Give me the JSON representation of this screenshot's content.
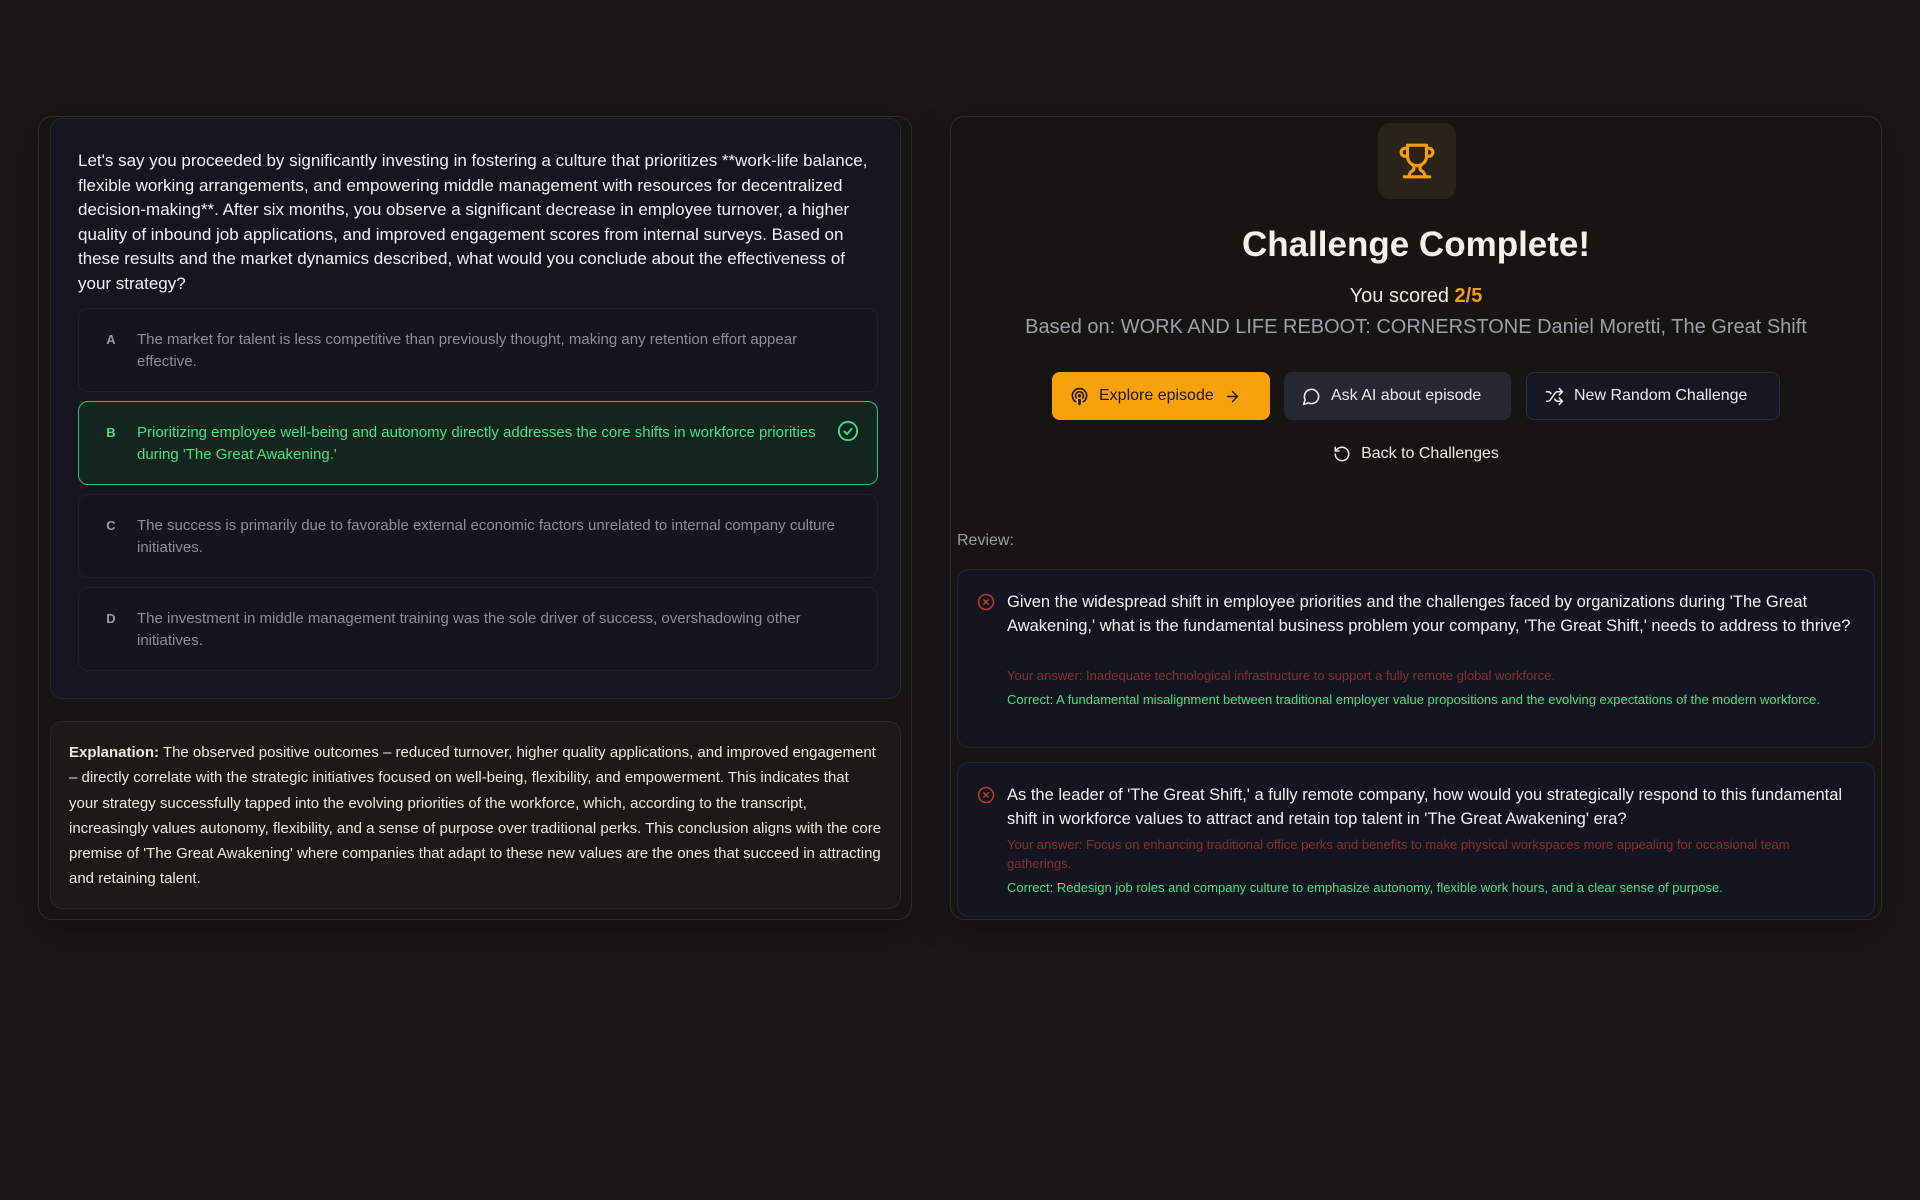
{
  "question": {
    "text": "Let's say you proceeded by significantly investing in fostering a culture that prioritizes **work-life balance, flexible working arrangements, and empowering middle management with resources for decentralized decision-making**. After six months, you observe a significant decrease in employee turnover, a higher quality of inbound job applications, and improved engagement scores from internal surveys. Based on these results and the market dynamics described, what would you conclude about the effectiveness of your strategy?",
    "options": [
      {
        "letter": "A",
        "text": "The market for talent is less competitive than previously thought, making any retention effort appear effective."
      },
      {
        "letter": "B",
        "text": "Prioritizing employee well-being and autonomy directly addresses the core shifts in workforce priorities during 'The Great Awakening.'",
        "correct": true
      },
      {
        "letter": "C",
        "text": "The success is primarily due to favorable external economic factors unrelated to internal company culture initiatives."
      },
      {
        "letter": "D",
        "text": "The investment in middle management training was the sole driver of success, overshadowing other initiatives."
      }
    ]
  },
  "explanation": {
    "label": "Explanation:",
    "text": "The observed positive outcomes – reduced turnover, higher quality applications, and improved engagement – directly correlate with the strategic initiatives focused on well-being, flexibility, and empowerment. This indicates that your strategy successfully tapped into the evolving priorities of the workforce, which, according to the transcript, increasingly values autonomy, flexibility, and a sense of purpose over traditional perks. This conclusion aligns with the core premise of 'The Great Awakening' where companies that adapt to these new values are the ones that succeed in attracting and retaining talent."
  },
  "result": {
    "title": "Challenge Complete!",
    "score_prefix": "You scored ",
    "score_value": "2/5",
    "based_on": "Based on: WORK AND LIFE REBOOT: CORNERSTONE Daniel Moretti, The Great Shift",
    "buttons": {
      "explore": "Explore episode",
      "ask": "Ask AI about episode",
      "new": "New Random Challenge"
    },
    "back": "Back to Challenges",
    "accent_color": "#f59e0b"
  },
  "review": {
    "label": "Review:",
    "items": [
      {
        "question": "Given the widespread shift in employee priorities and the challenges faced by organizations during 'The Great Awakening,' what is the fundamental business problem your company, 'The Great Shift,' needs to address to thrive?",
        "your_answer": "Your answer: Inadequate technological infrastructure to support a fully remote global workforce.",
        "correct": "Correct: A fundamental misalignment between traditional employer value propositions and the evolving expectations of the modern workforce."
      },
      {
        "question": "As the leader of 'The Great Shift,' a fully remote company, how would you strategically respond to this fundamental shift in workforce values to attract and retain top talent in 'The Great Awakening' era?",
        "your_answer": "Your answer: Focus on enhancing traditional office perks and benefits to make physical workspaces more appealing for occasional team gatherings.",
        "correct": "Correct: Redesign job roles and company culture to emphasize autonomy, flexible work hours, and a clear sense of purpose."
      }
    ]
  }
}
